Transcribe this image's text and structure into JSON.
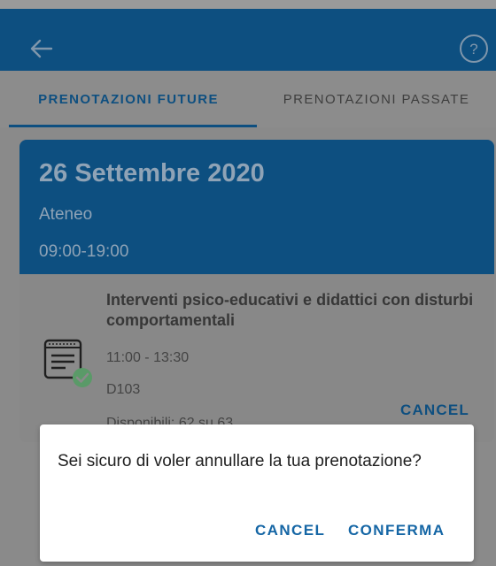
{
  "tabs": {
    "future": "PRENOTAZIONI FUTURE",
    "past": "PRENOTAZIONI PASSATE"
  },
  "booking": {
    "date": "26 Settembre 2020",
    "place": "Ateneo",
    "hours": "09:00-19:00",
    "course_title": "Interventi psico-educativi e didattici con disturbi comportamentali",
    "time": "11:00 - 13:30",
    "room": "D103",
    "availability": "Disponibili: 62 su 63",
    "cancel_label": "CANCEL"
  },
  "dialog": {
    "message": "Sei sicuro di voler annullare la tua prenotazione?",
    "cancel_label": "CANCEL",
    "confirm_label": "CONFERMA"
  },
  "icons": {
    "back": "arrow-left-icon",
    "help": "help-circle-icon",
    "document": "document-check-icon"
  },
  "colors": {
    "primary": "#0d4f80",
    "dialog_button": "#1566a5",
    "check_badge": "#5a9a68"
  }
}
